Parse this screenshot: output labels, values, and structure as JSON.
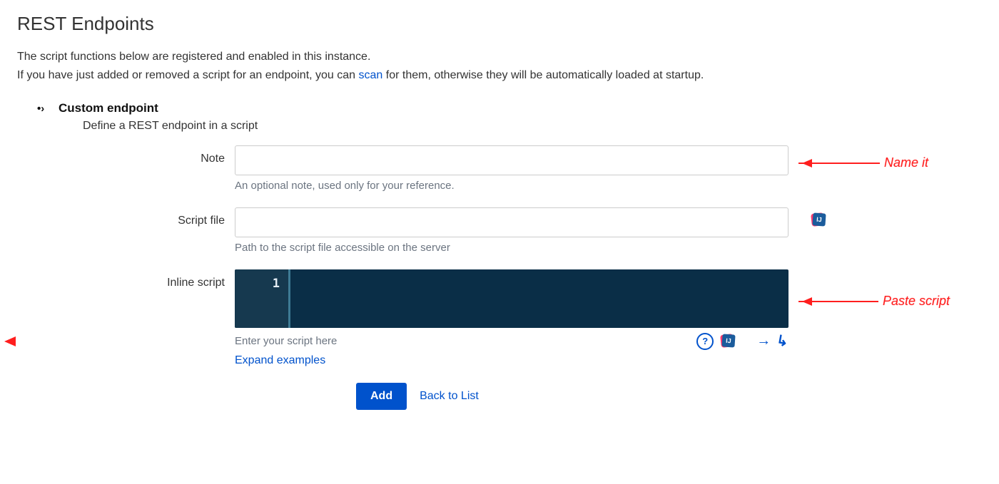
{
  "page": {
    "title": "REST Endpoints",
    "intro_line1": "The script functions below are registered and enabled in this instance.",
    "intro_line2_before": "If you have just added or removed a script for an endpoint, you can ",
    "intro_scan_link": "scan",
    "intro_line2_after": " for them, otherwise they will be automatically loaded at startup."
  },
  "section": {
    "glyph": "•›",
    "title": "Custom endpoint",
    "subtitle": "Define a REST endpoint in a script"
  },
  "form": {
    "note": {
      "label": "Note",
      "value": "",
      "help": "An optional note, used only for your reference."
    },
    "script_file": {
      "label": "Script file",
      "value": "",
      "help": "Path to the script file accessible on the server"
    },
    "inline_script": {
      "label": "Inline script",
      "line_number": "1",
      "help": "Enter your script here",
      "expand_link": "Expand examples"
    }
  },
  "buttons": {
    "add": "Add",
    "back": "Back to List"
  },
  "annotations": {
    "name_it": "Name it",
    "paste_script": "Paste script"
  },
  "icons": {
    "ij_badge": "intellij-badge-icon",
    "help": "help-icon",
    "arrow_right": "arrow-right-icon",
    "arrow_reply": "reply-arrow-icon"
  }
}
